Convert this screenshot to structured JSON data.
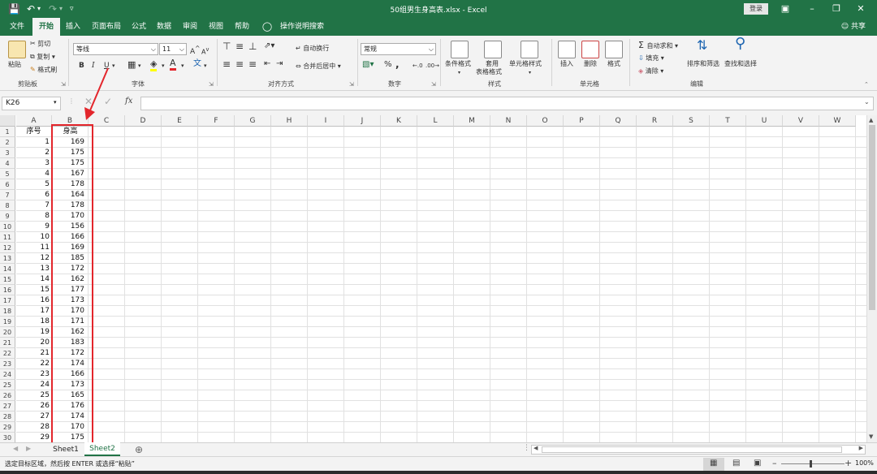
{
  "window": {
    "title": "50组男生身高表.xlsx  -  Excel",
    "login": "登录",
    "share": "共享"
  },
  "menu": {
    "tabs": [
      "文件",
      "开始",
      "插入",
      "页面布局",
      "公式",
      "数据",
      "审阅",
      "视图",
      "帮助"
    ],
    "active": "开始",
    "tell_me": "操作说明搜索"
  },
  "ribbon": {
    "clipboard": {
      "label": "剪贴板",
      "paste": "粘贴",
      "cut": "剪切",
      "copy": "复制",
      "format_painter": "格式刷"
    },
    "font": {
      "label": "字体",
      "font_name": "等线",
      "font_size": "11",
      "bold": "B",
      "italic": "I",
      "underline": "U",
      "grow": "A",
      "shrink": "A",
      "font_color_glyph": "A",
      "phonetic": "文"
    },
    "alignment": {
      "label": "对齐方式",
      "wrap": "自动换行",
      "merge": "合并后居中"
    },
    "number": {
      "label": "数字",
      "format": "常规",
      "percent": "%",
      "comma": ","
    },
    "styles": {
      "label": "样式",
      "conditional": "条件格式",
      "table_line1": "套用",
      "table_line2": "表格格式",
      "cell_styles": "单元格样式"
    },
    "cells": {
      "label": "单元格",
      "insert": "插入",
      "delete": "删除",
      "format": "格式"
    },
    "editing": {
      "label": "编辑",
      "autosum": "自动求和",
      "fill": "填充",
      "clear": "清除",
      "sort": "排序和筛选",
      "find": "查找和选择"
    }
  },
  "formula_bar": {
    "name_box": "K26",
    "fx": "fx",
    "content": ""
  },
  "columns": [
    "A",
    "B",
    "C",
    "D",
    "E",
    "F",
    "G",
    "H",
    "I",
    "J",
    "K",
    "L",
    "M",
    "N",
    "O",
    "P",
    "Q",
    "R",
    "S",
    "T",
    "U",
    "V",
    "W"
  ],
  "rows": [
    "1",
    "2",
    "3",
    "4",
    "5",
    "6",
    "7",
    "8",
    "9",
    "10",
    "11",
    "12",
    "13",
    "14",
    "15",
    "16",
    "17",
    "18",
    "19",
    "20",
    "21",
    "22",
    "23",
    "24",
    "25",
    "26",
    "27",
    "28",
    "29",
    "30"
  ],
  "header": {
    "a": "序号",
    "b": "身高"
  },
  "data": [
    {
      "a": "1",
      "b": "169"
    },
    {
      "a": "2",
      "b": "175"
    },
    {
      "a": "3",
      "b": "175"
    },
    {
      "a": "4",
      "b": "167"
    },
    {
      "a": "5",
      "b": "178"
    },
    {
      "a": "6",
      "b": "164"
    },
    {
      "a": "7",
      "b": "178"
    },
    {
      "a": "8",
      "b": "170"
    },
    {
      "a": "9",
      "b": "156"
    },
    {
      "a": "10",
      "b": "166"
    },
    {
      "a": "11",
      "b": "169"
    },
    {
      "a": "12",
      "b": "185"
    },
    {
      "a": "13",
      "b": "172"
    },
    {
      "a": "14",
      "b": "162"
    },
    {
      "a": "15",
      "b": "177"
    },
    {
      "a": "16",
      "b": "173"
    },
    {
      "a": "17",
      "b": "170"
    },
    {
      "a": "18",
      "b": "171"
    },
    {
      "a": "19",
      "b": "162"
    },
    {
      "a": "20",
      "b": "183"
    },
    {
      "a": "21",
      "b": "172"
    },
    {
      "a": "22",
      "b": "174"
    },
    {
      "a": "23",
      "b": "166"
    },
    {
      "a": "24",
      "b": "173"
    },
    {
      "a": "25",
      "b": "165"
    },
    {
      "a": "26",
      "b": "176"
    },
    {
      "a": "27",
      "b": "174"
    },
    {
      "a": "28",
      "b": "170"
    },
    {
      "a": "29",
      "b": "175"
    }
  ],
  "sheets": {
    "tab1": "Sheet1",
    "tab2": "Sheet2",
    "active": "Sheet2"
  },
  "status": {
    "message": "选定目标区域，然后按 ENTER 或选择“粘贴”",
    "zoom": "100%"
  },
  "colors": {
    "accent": "#217346",
    "annotation": "#e3262c"
  }
}
